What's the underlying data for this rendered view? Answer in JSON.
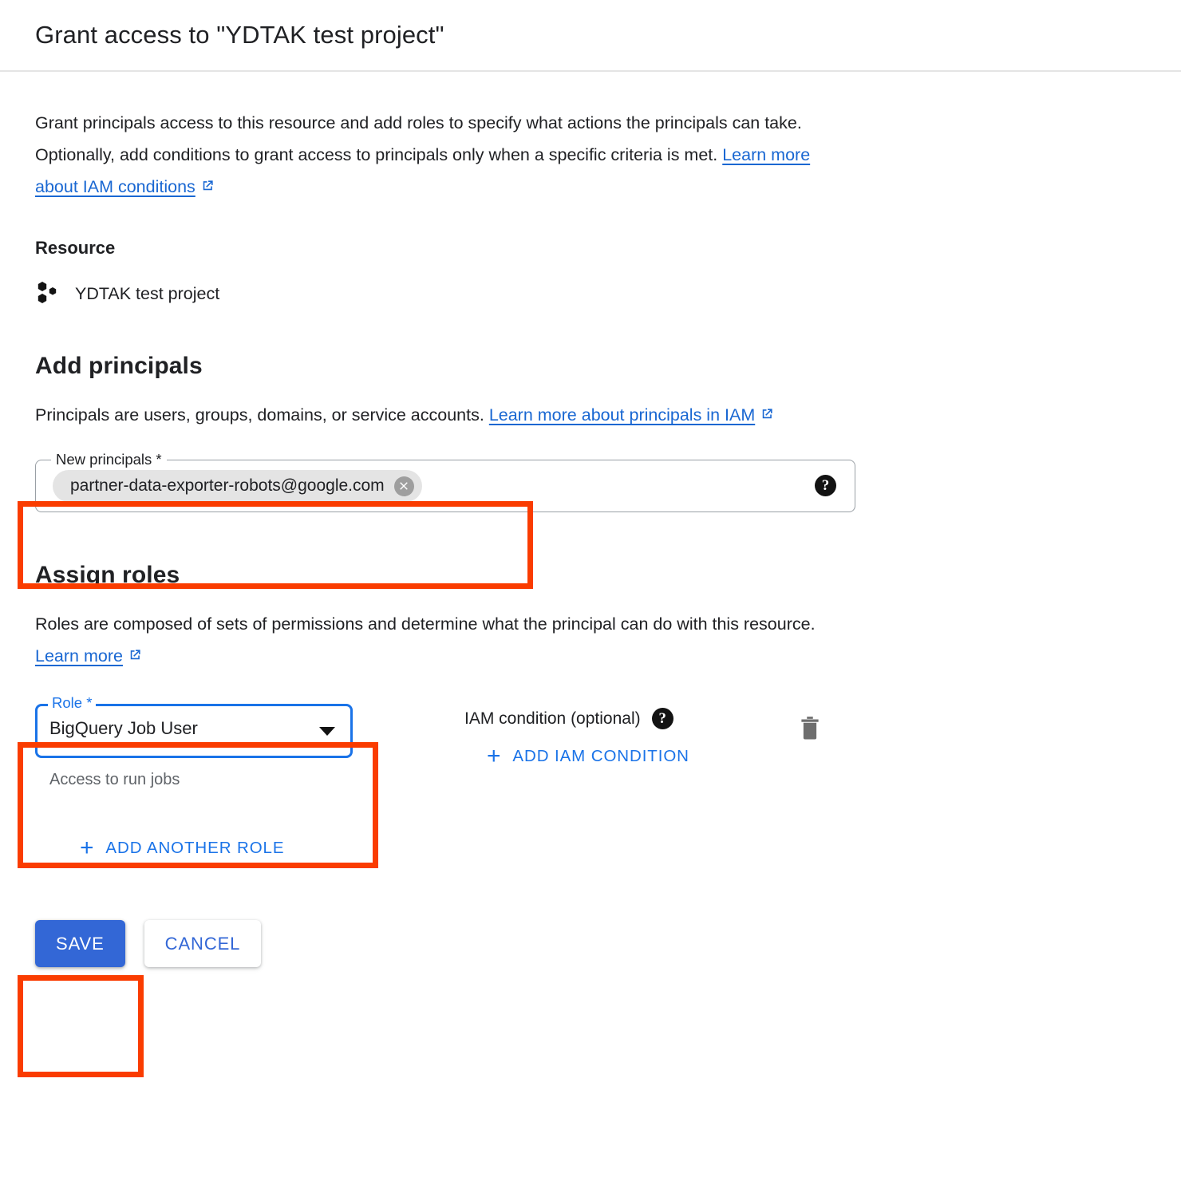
{
  "header": {
    "title": "Grant access to \"YDTAK test project\""
  },
  "intro": {
    "text": "Grant principals access to this resource and add roles to specify what actions the principals can take. Optionally, add conditions to grant access to principals only when a specific criteria is met. ",
    "link_label": "Learn more about IAM conditions",
    "link_icon": "external-link-icon"
  },
  "resource": {
    "heading": "Resource",
    "icon": "gcp-project-icon",
    "name": "YDTAK test project"
  },
  "principals": {
    "heading": "Add principals",
    "desc_text": "Principals are users, groups, domains, or service accounts. ",
    "desc_link": "Learn more about principals in IAM",
    "field_label": "New principals *",
    "chip_value": "partner-data-exporter-robots@google.com",
    "chip_remove_icon": "close-circle-icon",
    "help_icon": "help-icon",
    "help_glyph": "?"
  },
  "roles": {
    "heading": "Assign roles",
    "desc_text": "Roles are composed of sets of permissions and determine what the principal can do with this resource. ",
    "desc_link": "Learn more",
    "role_label": "Role *",
    "role_value": "BigQuery Job User",
    "role_hint": "Access to run jobs",
    "dropdown_icon": "chevron-down-icon",
    "condition_label": "IAM condition (optional)",
    "condition_help_icon": "help-icon",
    "condition_help_glyph": "?",
    "add_condition_label": "ADD IAM CONDITION",
    "add_condition_icon": "plus-icon",
    "delete_icon": "trash-icon",
    "add_role_label": "ADD ANOTHER ROLE",
    "add_role_icon": "plus-icon"
  },
  "actions": {
    "save_label": "SAVE",
    "cancel_label": "CANCEL"
  },
  "annotations": {
    "principals_box": "highlight-new-principals-field",
    "role_box": "highlight-role-select",
    "save_box": "highlight-save-button"
  },
  "colors": {
    "accent_blue": "#1a73e8",
    "button_blue": "#3367d6",
    "link_blue": "#1967d2",
    "annotation_red": "#fa3c00",
    "hint_gray": "#5f6368",
    "divider_gray": "#e4e4e4"
  }
}
